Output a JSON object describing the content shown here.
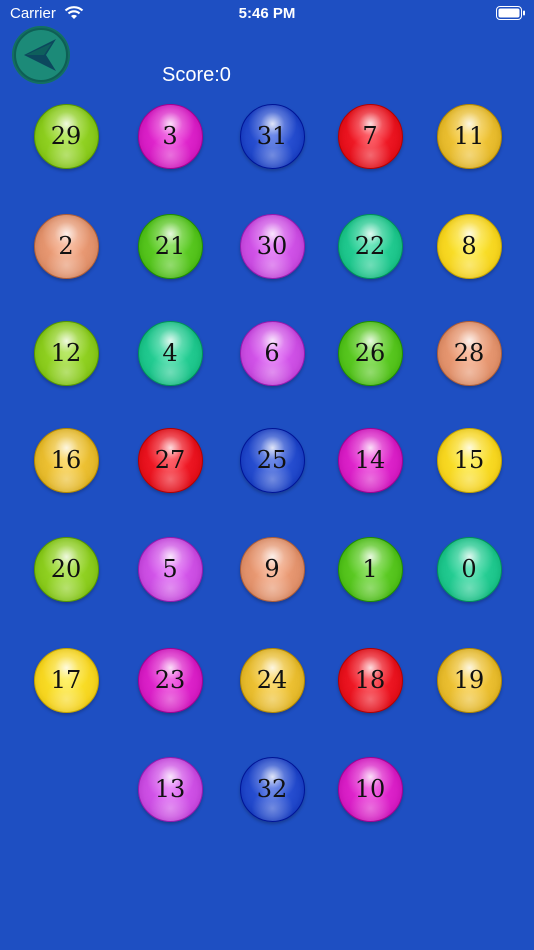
{
  "status_bar": {
    "carrier": "Carrier",
    "time": "5:46 PM"
  },
  "header": {
    "score_label": "Score:0"
  },
  "colors": {
    "background": "#1e4fc2",
    "lime": "#88c91a",
    "magenta": "#d61cc3",
    "blue": "#1f46c8",
    "red": "#e6101c",
    "gold": "#e5b92b",
    "peach": "#e0906a",
    "green": "#52c11a",
    "violet": "#c94be0",
    "teal": "#1cc48a",
    "yellow": "#f5d41e"
  },
  "balls": [
    {
      "label": "29",
      "color": "lime"
    },
    {
      "label": "3",
      "color": "magenta"
    },
    {
      "label": "31",
      "color": "blue"
    },
    {
      "label": "7",
      "color": "red"
    },
    {
      "label": "11",
      "color": "gold"
    },
    {
      "label": "2",
      "color": "peach"
    },
    {
      "label": "21",
      "color": "green"
    },
    {
      "label": "30",
      "color": "violet"
    },
    {
      "label": "22",
      "color": "teal"
    },
    {
      "label": "8",
      "color": "yellow"
    },
    {
      "label": "12",
      "color": "lime"
    },
    {
      "label": "4",
      "color": "teal"
    },
    {
      "label": "6",
      "color": "violet"
    },
    {
      "label": "26",
      "color": "green"
    },
    {
      "label": "28",
      "color": "peach"
    },
    {
      "label": "16",
      "color": "gold"
    },
    {
      "label": "27",
      "color": "red"
    },
    {
      "label": "25",
      "color": "blue"
    },
    {
      "label": "14",
      "color": "magenta"
    },
    {
      "label": "15",
      "color": "yellow"
    },
    {
      "label": "20",
      "color": "lime"
    },
    {
      "label": "5",
      "color": "violet"
    },
    {
      "label": "9",
      "color": "peach"
    },
    {
      "label": "1",
      "color": "green"
    },
    {
      "label": "0",
      "color": "teal"
    },
    {
      "label": "17",
      "color": "yellow"
    },
    {
      "label": "23",
      "color": "magenta"
    },
    {
      "label": "24",
      "color": "gold"
    },
    {
      "label": "18",
      "color": "red"
    },
    {
      "label": "19",
      "color": "gold"
    },
    {
      "label": "13",
      "color": "violet"
    },
    {
      "label": "32",
      "color": "blue"
    },
    {
      "label": "10",
      "color": "magenta"
    }
  ]
}
